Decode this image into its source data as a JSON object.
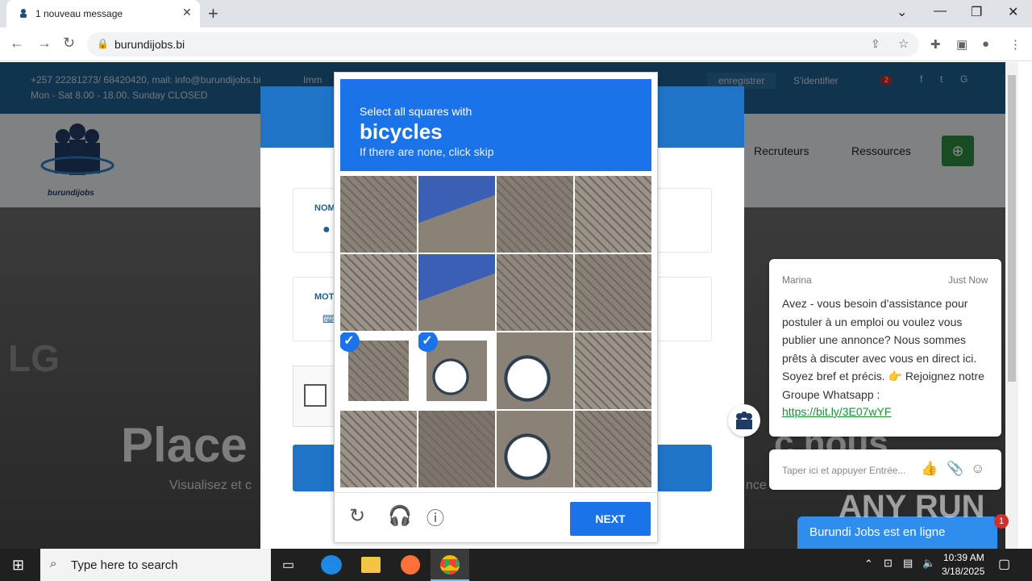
{
  "browser": {
    "tab_title": "1 nouveau message",
    "url": "burundijobs.bi"
  },
  "site": {
    "contact": "+257 22281273/ 68420420, mail: info@burundijobs.bi",
    "address_fragment": "Imm",
    "hours": "Mon - Sat 8.00 - 18.00. Sunday CLOSED",
    "register": "enregistrer",
    "login": "S'identifier",
    "notif_count": "2",
    "logo_text": "burundijobs",
    "nav": [
      "Recruteurs",
      "Ressources"
    ],
    "hero_title": "Place",
    "hero_title_end": "c nous",
    "hero_sub": "Visualisez et c",
    "hero_sub_end": "nce",
    "field_labels": [
      "NOM",
      "MOT"
    ],
    "watermark": "LG"
  },
  "captcha": {
    "line1": "Select all squares with",
    "target": "bicycles",
    "line3": "If there are none, click skip",
    "next": "NEXT",
    "selected_tiles": [
      8,
      9
    ],
    "colors": {
      "accent": "#1a73e8"
    }
  },
  "chat": {
    "agent": "Marina",
    "time": "Just Now",
    "message": "Avez - vous besoin d'assistance pour postuler à un emploi ou voulez vous publier une annonce? Nous sommes prêts à discuter avec vous en direct ici. Soyez bref et précis. 👉 Rejoignez notre Groupe Whatsapp :",
    "link": "https://bit.ly/3E07wYF",
    "input_placeholder": "Taper ici et appuyer Entrée...",
    "status": "Burundi Jobs est en ligne",
    "badge": "1"
  },
  "taskbar": {
    "search_placeholder": "Type here to search",
    "time": "10:39 AM",
    "date": "3/18/2025"
  },
  "brand_watermark": "ANY RUN"
}
